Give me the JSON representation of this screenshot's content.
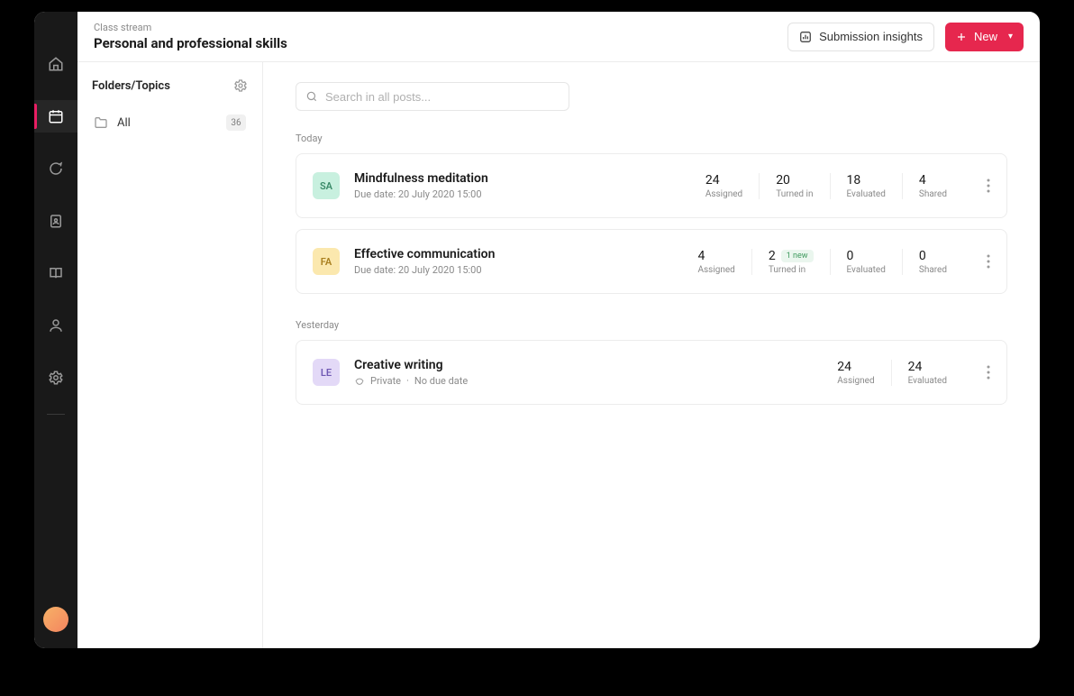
{
  "header": {
    "crumb": "Class stream",
    "title": "Personal and professional skills",
    "insights_label": "Submission insights",
    "new_label": "New"
  },
  "folders": {
    "title": "Folders/Topics",
    "items": [
      {
        "name": "All",
        "count": "36"
      }
    ]
  },
  "search": {
    "placeholder": "Search in all posts..."
  },
  "groups": [
    {
      "label": "Today",
      "posts": [
        {
          "badge": "SA",
          "badge_color": "green",
          "title": "Mindfulness meditation",
          "sub": "Due date: 20 July 2020 15:00",
          "private": false,
          "stats": [
            {
              "val": "24",
              "lbl": "Assigned"
            },
            {
              "val": "20",
              "lbl": "Turned in"
            },
            {
              "val": "18",
              "lbl": "Evaluated"
            },
            {
              "val": "4",
              "lbl": "Shared"
            }
          ]
        },
        {
          "badge": "FA",
          "badge_color": "yellow",
          "title": "Effective communication",
          "sub": "Due date: 20 July 2020 15:00",
          "private": false,
          "stats": [
            {
              "val": "4",
              "lbl": "Assigned"
            },
            {
              "val": "2",
              "lbl": "Turned in",
              "new": "1 new"
            },
            {
              "val": "0",
              "lbl": "Evaluated"
            },
            {
              "val": "0",
              "lbl": "Shared"
            }
          ]
        }
      ]
    },
    {
      "label": "Yesterday",
      "posts": [
        {
          "badge": "LE",
          "badge_color": "purple",
          "title": "Creative writing",
          "sub": "No due date",
          "private": true,
          "private_label": "Private",
          "stats": [
            {
              "val": "24",
              "lbl": "Assigned"
            },
            {
              "val": "24",
              "lbl": "Evaluated"
            }
          ]
        }
      ]
    }
  ]
}
